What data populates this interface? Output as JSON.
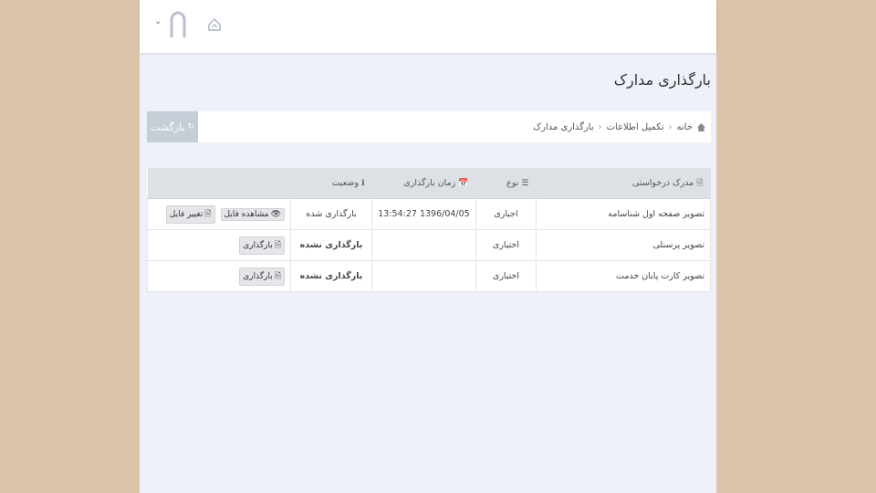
{
  "page_title": "بارگذاری مدارک",
  "breadcrumb": {
    "items": [
      "خانه",
      "تکمیل اطلاعات",
      "بارگذاری مدارک"
    ],
    "home_icon": "home-icon"
  },
  "back_button": {
    "label": "بازگشت",
    "icon": "refresh-icon"
  },
  "table": {
    "headers": {
      "document": "مدرک درخواستی",
      "type": "نوع",
      "upload_time": "زمان بارگذاری",
      "status": "وضعیت"
    },
    "rows": [
      {
        "document": "تصویر صفحه اول شناسامه",
        "type": "اجباری",
        "upload_time": "1396/04/05 13:54:27",
        "status": "بارگذاری شده",
        "actions": [
          "مشاهده فایل",
          "تغییر فایل"
        ]
      },
      {
        "document": "تصویر پرسنلی",
        "type": "اختیاری",
        "upload_time": "",
        "status": "بارگذاری نشده",
        "actions": [
          "بارگذاری"
        ]
      },
      {
        "document": "تصویر کارت پایان خدمت",
        "type": "اختیاری",
        "upload_time": "",
        "status": "بارگذاری نشده",
        "actions": [
          "بارگذاری"
        ]
      }
    ]
  },
  "colors": {
    "background": "#dbc3a9",
    "content": "#eef1f9",
    "status_done": "#3a55b5",
    "back_button": "#c5cdd6"
  }
}
